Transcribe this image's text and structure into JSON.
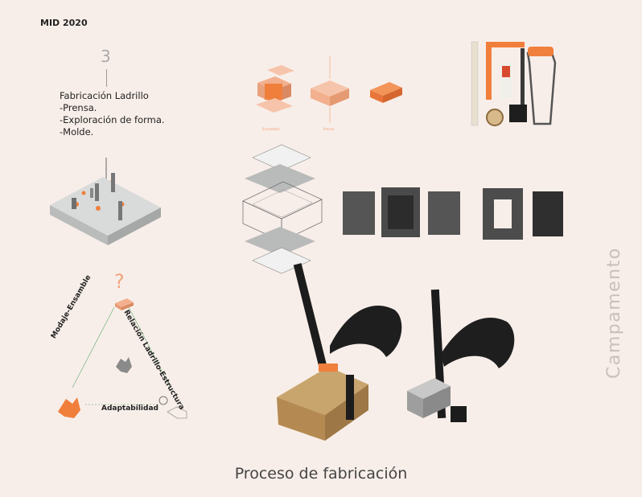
{
  "header": {
    "label": "MID 2020"
  },
  "step": {
    "number": "3",
    "lines": [
      "Fabricación Ladrillo",
      "-Prensa.",
      "-Exploración de forma.",
      "-Molde."
    ]
  },
  "side_title": "Campamento",
  "bottom_title": "Proceso de fabricación",
  "brick_labels": [
    "Ensambles",
    "Prensa"
  ],
  "triangle": {
    "left": "Modaje-Ensamble",
    "right": "Relación Ladrillo-Estructura",
    "bottom": "Adaptabilidad",
    "top_symbol": "?"
  },
  "colors": {
    "background": "#f8eee9",
    "accent": "#f07f3c",
    "accent_light": "#f6b08a",
    "pale_pink": "#f2c6b3",
    "grey_plate": "#cfd2d1",
    "mold_dark": "#4d4d4d"
  }
}
